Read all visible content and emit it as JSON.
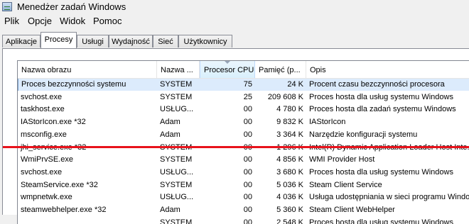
{
  "window": {
    "title": "Menedżer zadań Windows"
  },
  "menu": [
    "Plik",
    "Opcje",
    "Widok",
    "Pomoc"
  ],
  "tabs": [
    "Aplikacje",
    "Procesy",
    "Usługi",
    "Wydajność",
    "Sieć",
    "Użytkownicy"
  ],
  "active_tab": "Procesy",
  "columns": [
    "Nazwa obrazu",
    "Nazwa ...",
    "Procesor CPU",
    "Pamięć (p...",
    "Opis"
  ],
  "sorted_column": "Procesor CPU",
  "annotation": {
    "color": "#e8121b"
  },
  "rows": [
    {
      "name": "Proces bezczynności systemu",
      "user": "SYSTEM",
      "cpu": "75",
      "mem": "24 K",
      "desc": "Procent czasu bezczynności procesora",
      "highlight": true
    },
    {
      "name": "svchost.exe",
      "user": "SYSTEM",
      "cpu": "25",
      "mem": "209 608 K",
      "desc": "Proces hosta dla usług systemu Windows"
    },
    {
      "name": "taskhost.exe",
      "user": "USŁUG...",
      "cpu": "00",
      "mem": "4 780 K",
      "desc": "Proces hosta dla zadań systemu Windows"
    },
    {
      "name": "IAStorIcon.exe *32",
      "user": "Adam",
      "cpu": "00",
      "mem": "9 832 K",
      "desc": "IAStorIcon"
    },
    {
      "name": "msconfig.exe",
      "user": "Adam",
      "cpu": "00",
      "mem": "3 364 K",
      "desc": "Narzędzie konfiguracji systemu"
    },
    {
      "name": "jhi_service.exe *32",
      "user": "SYSTEM",
      "cpu": "00",
      "mem": "1 296 K",
      "desc": "Intel(R) Dynamic Application Loader Host Inte..."
    },
    {
      "name": "WmiPrvSE.exe",
      "user": "SYSTEM",
      "cpu": "00",
      "mem": "4 856 K",
      "desc": "WMI Provider Host"
    },
    {
      "name": "svchost.exe",
      "user": "USŁUG...",
      "cpu": "00",
      "mem": "3 680 K",
      "desc": "Proces hosta dla usług systemu Windows"
    },
    {
      "name": "SteamService.exe *32",
      "user": "SYSTEM",
      "cpu": "00",
      "mem": "5 036 K",
      "desc": "Steam Client Service"
    },
    {
      "name": "wmpnetwk.exe",
      "user": "USŁUG...",
      "cpu": "00",
      "mem": "4 036 K",
      "desc": "Usługa udostępniania w sieci programu Windo..."
    },
    {
      "name": "steamwebhelper.exe *32",
      "user": "Adam",
      "cpu": "00",
      "mem": "5 360 K",
      "desc": "Steam Client WebHelper"
    },
    {
      "name": "",
      "user": "SYSTEM",
      "cpu": "00",
      "mem": "2 548 K",
      "desc": "Proces hosta dla usług systemu Windows"
    }
  ]
}
